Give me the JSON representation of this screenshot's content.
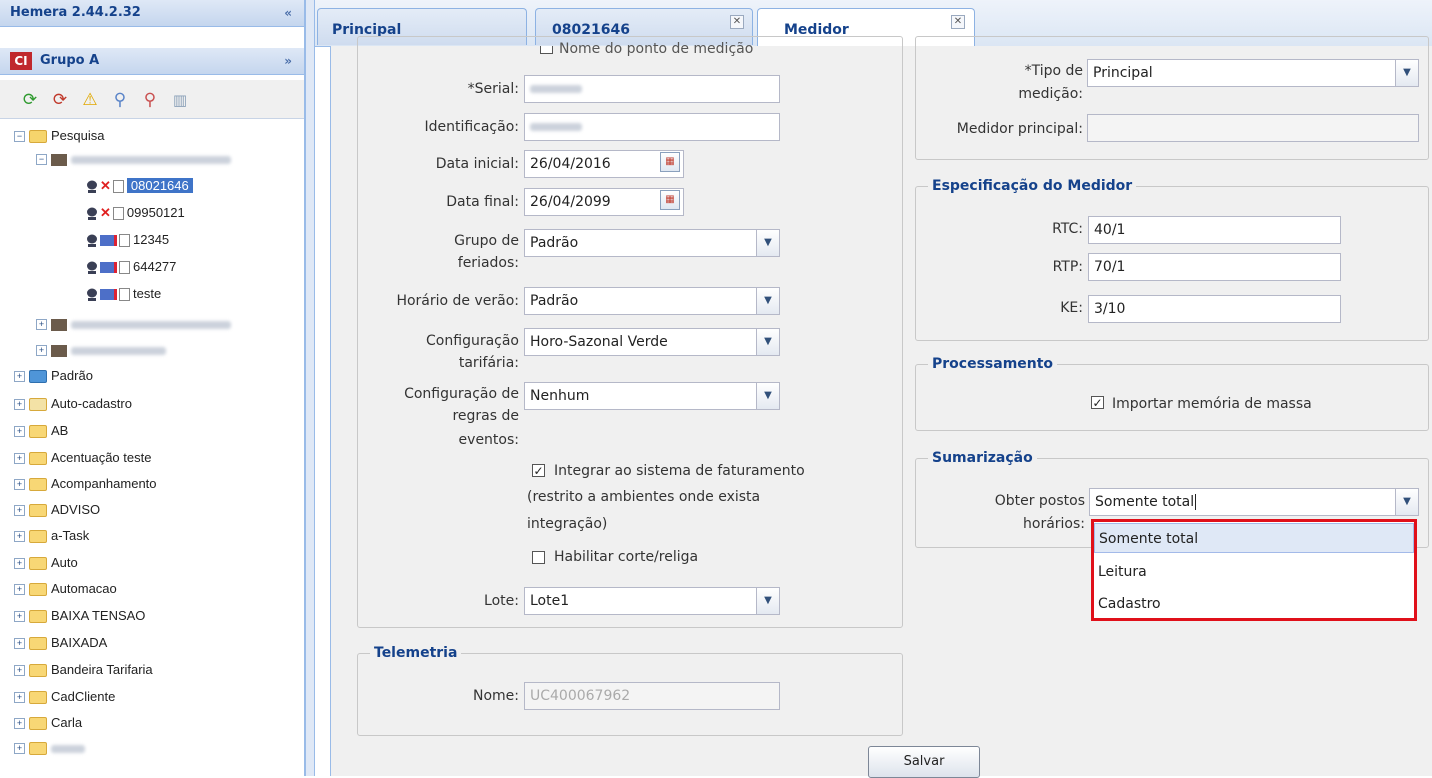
{
  "app": {
    "title": "Hemera 2.44.2.32",
    "collapse_icon": "«"
  },
  "group": {
    "logo": "CI",
    "title": "Grupo A",
    "expand_icon": "»"
  },
  "toolbar": {
    "icons": [
      "refresh-green-icon",
      "refresh-red-icon",
      "warning-icon",
      "search-icon",
      "search-red-icon",
      "clipboard-icon"
    ]
  },
  "tree": {
    "root": "Pesquisa",
    "meters": [
      "08021646",
      "09950121",
      "12345",
      "644277",
      "teste"
    ],
    "folders": [
      "Padrão",
      "Auto-cadastro",
      "AB",
      "Acentuação teste",
      "Acompanhamento",
      "ADVISO",
      "a-Task",
      "Auto",
      "Automacao",
      "BAIXA TENSAO",
      "BAIXADA",
      "Bandeira Tarifaria",
      "CadCliente",
      "Carla"
    ]
  },
  "tabs": [
    "Principal",
    "08021646",
    "Medidor"
  ],
  "form": {
    "partial_top": "Nome do ponto de medição",
    "serial_label": "*Serial:",
    "ident_label": "Identificação:",
    "data_inicial_label": "Data inicial:",
    "data_inicial": "26/04/2016",
    "data_final_label": "Data final:",
    "data_final": "26/04/2099",
    "grupo_feriados_label1": "Grupo de",
    "grupo_feriados_label2": "feriados:",
    "grupo_feriados": "Padrão",
    "horario_verao_label": "Horário de verão:",
    "horario_verao": "Padrão",
    "config_tarifaria_label1": "Configuração",
    "config_tarifaria_label2": "tarifária:",
    "config_tarifaria": "Horo-Sazonal Verde",
    "config_regras_label1": "Configuração de",
    "config_regras_label2": "regras de",
    "config_regras_label3": "eventos:",
    "config_regras": "Nenhum",
    "integrar_line1": "Integrar ao sistema de faturamento",
    "integrar_line2": "(restrito a ambientes onde exista",
    "integrar_line3": "integração)",
    "corte_label": "Habilitar corte/religa",
    "lote_label": "Lote:",
    "lote": "Lote1"
  },
  "telemetria": {
    "legend": "Telemetria",
    "nome_label": "Nome:",
    "nome": "UC400067962"
  },
  "right": {
    "tipo_label1": "*Tipo de",
    "tipo_label2": "medição:",
    "tipo": "Principal",
    "medidor_principal_label": "Medidor principal:",
    "spec_legend": "Especificação do Medidor",
    "rtc_label": "RTC:",
    "rtc": "40/1",
    "rtp_label": "RTP:",
    "rtp": "70/1",
    "ke_label": "KE:",
    "ke": "3/10",
    "proc_legend": "Processamento",
    "importar_label": "Importar memória de massa",
    "sum_legend": "Sumarização",
    "postos_label1": "Obter postos",
    "postos_label2": "horários:",
    "postos": "Somente total",
    "options": [
      "Somente total",
      "Leitura",
      "Cadastro"
    ]
  },
  "save_label": "Salvar",
  "colors": {
    "header": "#15428b",
    "highlight": "#e0101a",
    "selection": "#3f74c8"
  }
}
